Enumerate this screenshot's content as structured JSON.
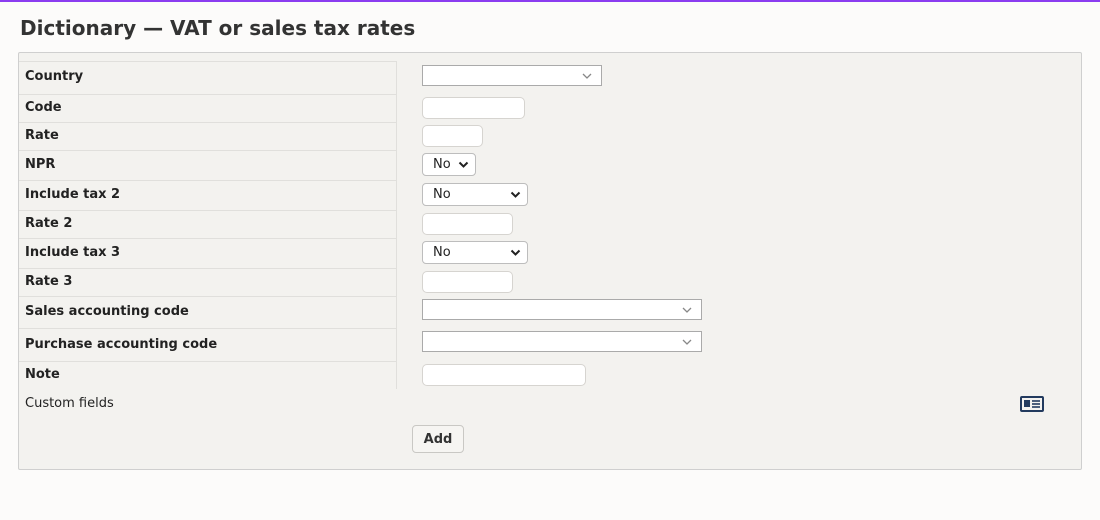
{
  "page": {
    "title": "Dictionary — VAT or sales tax rates"
  },
  "form": {
    "rows": [
      {
        "label": "Country"
      },
      {
        "label": "Code"
      },
      {
        "label": "Rate"
      },
      {
        "label": "NPR",
        "value": "No"
      },
      {
        "label": "Include tax 2",
        "value": "No"
      },
      {
        "label": "Rate 2"
      },
      {
        "label": "Include tax 3",
        "value": "No"
      },
      {
        "label": "Rate 3"
      },
      {
        "label": "Sales accounting code"
      },
      {
        "label": "Purchase accounting code"
      },
      {
        "label": "Note"
      }
    ],
    "custom_fields_label": "Custom fields",
    "add_label": "Add"
  },
  "colors": {
    "accent": "#8b3cf0",
    "panel_bg": "#f3f2ef",
    "page_bg": "#fcfbfa"
  },
  "icons": {
    "extrafields": "list-card-icon",
    "dropdown": "chevron-down-icon"
  }
}
